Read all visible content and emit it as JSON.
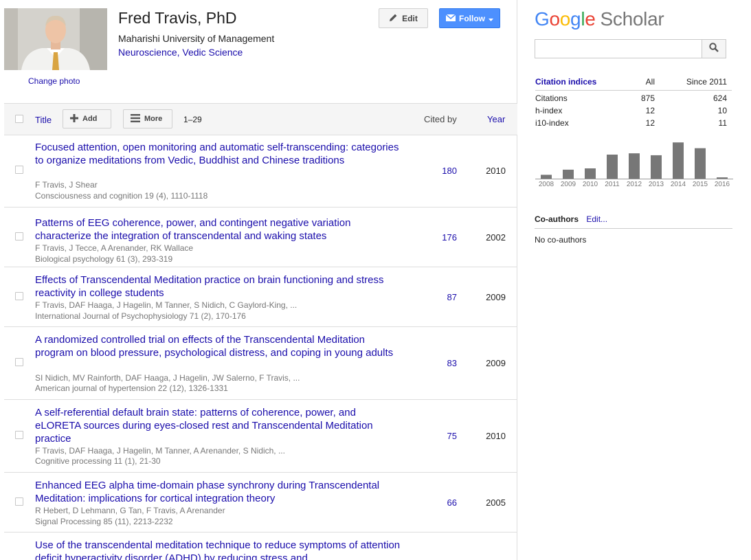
{
  "profile": {
    "name": "Fred Travis, PhD",
    "affiliation": "Maharishi University of Management",
    "interests": [
      "Neuroscience",
      "Vedic Science"
    ],
    "interest_separator": ", ",
    "change_photo": "Change photo"
  },
  "header_buttons": {
    "edit": "Edit",
    "follow": "Follow"
  },
  "toolbar": {
    "title": "Title",
    "add": "Add",
    "more": "More",
    "range": "1–29",
    "cited_by": "Cited by",
    "year": "Year"
  },
  "articles": [
    {
      "title": "Focused attention, open monitoring and automatic self-transcending: categories to organize meditations from Vedic, Buddhist and Chinese traditions",
      "authors": "F Travis, J Shear",
      "venue": "Consciousness and cognition 19 (4), 1110-1118",
      "cited": "180",
      "year": "2010"
    },
    {
      "title": "Patterns of EEG coherence, power, and contingent negative variation characterize the integration of transcendental and waking states",
      "authors": "F Travis, J Tecce, A Arenander, RK Wallace",
      "venue": "Biological psychology 61 (3), 293-319",
      "cited": "176",
      "year": "2002"
    },
    {
      "title": "Effects of Transcendental Meditation practice on brain functioning and stress reactivity in college students",
      "authors": "F Travis, DAF Haaga, J Hagelin, M Tanner, S Nidich, C Gaylord-King, ...",
      "venue": "International Journal of Psychophysiology 71 (2), 170-176",
      "cited": "87",
      "year": "2009"
    },
    {
      "title": "A randomized controlled trial on effects of the Transcendental Meditation program on blood pressure, psychological distress, and coping in young adults",
      "authors": "SI Nidich, MV Rainforth, DAF Haaga, J Hagelin, JW Salerno, F Travis, ...",
      "venue": "American journal of hypertension 22 (12), 1326-1331",
      "cited": "83",
      "year": "2009"
    },
    {
      "title": "A self-referential default brain state: patterns of coherence, power, and eLORETA sources during eyes-closed rest and Transcendental Meditation practice",
      "authors": "F Travis, DAF Haaga, J Hagelin, M Tanner, A Arenander, S Nidich, ...",
      "venue": "Cognitive processing 11 (1), 21-30",
      "cited": "75",
      "year": "2010"
    },
    {
      "title": "Enhanced EEG alpha time-domain phase synchrony during Transcendental Meditation: implications for cortical integration theory",
      "authors": "R Hebert, D Lehmann, G Tan, F Travis, A Arenander",
      "venue": "Signal Processing 85 (11), 2213-2232",
      "cited": "66",
      "year": "2005"
    },
    {
      "title": "Use of the transcendental meditation technique to reduce symptoms of attention deficit hyperactivity disorder (ADHD) by reducing stress and",
      "authors": "",
      "venue": "",
      "cited": "",
      "year": ""
    }
  ],
  "scholar": {
    "logo_google": [
      "G",
      "o",
      "o",
      "g",
      "l",
      "e"
    ],
    "logo_scholar": "Scholar",
    "search_placeholder": ""
  },
  "citation_indices": {
    "heading": "Citation indices",
    "col_all": "All",
    "col_since": "Since 2011",
    "rows": [
      {
        "label": "Citations",
        "all": "875",
        "since": "624"
      },
      {
        "label": "h-index",
        "all": "12",
        "since": "10"
      },
      {
        "label": "i10-index",
        "all": "12",
        "since": "11"
      }
    ]
  },
  "chart_data": {
    "type": "bar",
    "categories": [
      "2008",
      "2009",
      "2010",
      "2011",
      "2012",
      "2013",
      "2014",
      "2015",
      "2016"
    ],
    "values": [
      12,
      28,
      32,
      75,
      79,
      73,
      113,
      95,
      4
    ],
    "ylim": [
      0,
      120
    ],
    "bar_color": "#777777"
  },
  "coauthors": {
    "heading": "Co-authors",
    "edit": "Edit...",
    "none": "No co-authors"
  },
  "colors": {
    "link": "#1a0dab",
    "follow_button": "#4d90fe"
  }
}
